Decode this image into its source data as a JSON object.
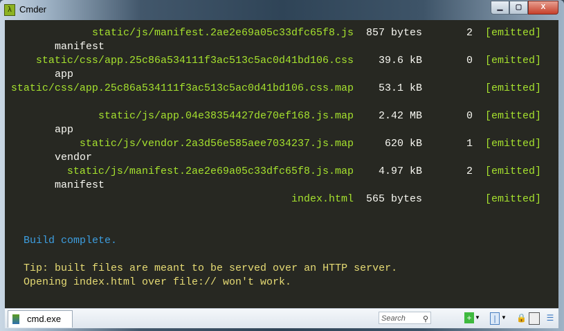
{
  "window": {
    "title": "Cmder",
    "app_icon": "lambda-icon",
    "buttons": {
      "minimize": "minimize-icon",
      "maximize": "maximize-icon",
      "close": "close-icon"
    }
  },
  "terminal": {
    "rows": [
      {
        "asset": "static/js/manifest.2ae2e69a05c33dfc65f8.js",
        "size": "857 bytes",
        "chunk": "2",
        "status": "[emitted]"
      },
      {
        "chunk_name": "manifest"
      },
      {
        "asset": "static/css/app.25c86a534111f3ac513c5ac0d41bd106.css",
        "size": "39.6 kB",
        "chunk": "0",
        "status": "[emitted]"
      },
      {
        "chunk_name": "app"
      },
      {
        "asset": "static/css/app.25c86a534111f3ac513c5ac0d41bd106.css.map",
        "size": "53.1 kB",
        "chunk": "",
        "status": "[emitted]"
      },
      {},
      {
        "asset": "static/js/app.04e38354427de70ef168.js.map",
        "size": "2.42 MB",
        "chunk": "0",
        "status": "[emitted]"
      },
      {
        "chunk_name": "app"
      },
      {
        "asset": "static/js/vendor.2a3d56e585aee7034237.js.map",
        "size": "620 kB",
        "chunk": "1",
        "status": "[emitted]"
      },
      {
        "chunk_name": "vendor"
      },
      {
        "asset": "static/js/manifest.2ae2e69a05c33dfc65f8.js.map",
        "size": "4.97 kB",
        "chunk": "2",
        "status": "[emitted]"
      },
      {
        "chunk_name": "manifest"
      },
      {
        "asset": "index.html",
        "size": "565 bytes",
        "chunk": "",
        "status": "[emitted]"
      }
    ],
    "build_complete": "Build complete.",
    "tip_line1": "Tip: built files are meant to be served over an HTTP server.",
    "tip_line2": "Opening index.html over file:// won't work."
  },
  "statusbar": {
    "tab_label": "cmd.exe",
    "search_placeholder": "Search"
  },
  "colors": {
    "background": "#272822",
    "asset": "#a6e22e",
    "text": "#f8f8f2",
    "info": "#3d9ee0",
    "tip": "#e6db74"
  }
}
